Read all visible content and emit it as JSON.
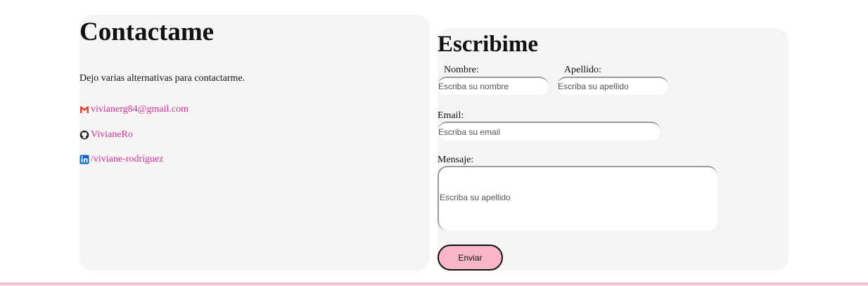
{
  "contact": {
    "title": "Contactame",
    "intro": "Dejo varias alternativas para contactarme.",
    "links": [
      {
        "icon": "gmail-icon",
        "text": "vivianerg84@gmail.com"
      },
      {
        "icon": "github-icon",
        "text": "VivianeRo"
      },
      {
        "icon": "linkedin-icon",
        "text": "/viviane-rodríguez"
      }
    ],
    "link_color": "#d1319a"
  },
  "form": {
    "title": "Escribime",
    "nombre": {
      "label": "Nombre:",
      "placeholder": "Escriba su nombre",
      "value": ""
    },
    "apellido": {
      "label": "Apellido:",
      "placeholder": "Escriba su apellido",
      "value": ""
    },
    "email": {
      "label": "Email:",
      "placeholder": "Escriba su email",
      "value": ""
    },
    "mensaje": {
      "label": "Mensaje:",
      "placeholder": "Escriba su apellido",
      "value": ""
    },
    "submit_label": "Enviar",
    "submit_color": "#f9b6c8"
  },
  "colors": {
    "panel_background": "#f7f5f4",
    "footer_line": "#f4bfd4"
  }
}
